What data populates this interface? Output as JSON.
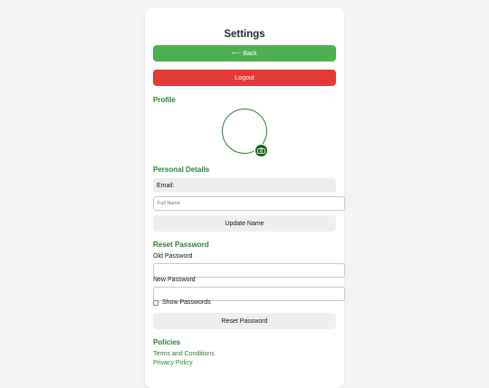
{
  "page": {
    "title": "Settings"
  },
  "buttons": {
    "back": "⟵ Back",
    "logout": "Logout",
    "update_name": "Update Name",
    "reset_password": "Reset Password"
  },
  "profile": {
    "heading": "Profile",
    "avatar_edit_icon": "camera-icon",
    "accent_color": "#2e7d32"
  },
  "personal": {
    "heading": "Personal Details",
    "email_label": "Email:",
    "full_name_placeholder": "Full Name"
  },
  "reset": {
    "heading": "Reset Password",
    "old_label": "Old Password",
    "new_label": "New Password",
    "show_passwords": "Show Passwords",
    "show_checked": false
  },
  "policies": {
    "heading": "Policies",
    "links": [
      "Terms and Conditions",
      "Privacy Policy"
    ]
  },
  "colors": {
    "back_button": "#4caf50",
    "logout_button": "#e53935",
    "heading": "#2e7d32"
  }
}
